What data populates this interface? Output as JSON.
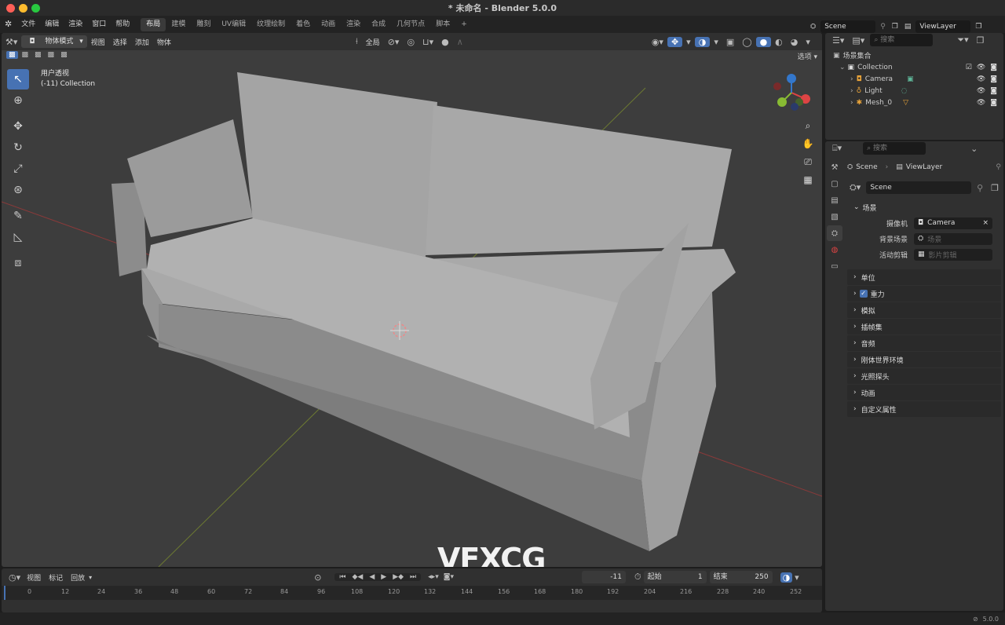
{
  "window": {
    "title": "* 未命名 - Blender 5.0.0"
  },
  "menu": {
    "items": [
      "文件",
      "编辑",
      "渲染",
      "窗口",
      "帮助"
    ],
    "workspaces": [
      "布局",
      "建模",
      "雕刻",
      "UV编辑",
      "纹理绘制",
      "着色",
      "动画",
      "渲染",
      "合成",
      "几何节点",
      "脚本"
    ],
    "add_tab": "+",
    "scene": "Scene",
    "view_layer": "ViewLayer"
  },
  "viewport": {
    "mode": "物体模式",
    "menus": [
      "视图",
      "选择",
      "添加",
      "物体"
    ],
    "orientation": "全局",
    "options_label": "选项",
    "overlay_title": "用户透视",
    "overlay_sub": "(-11) Collection"
  },
  "timeline": {
    "menus": [
      "视图",
      "标记",
      "回放"
    ],
    "current_frame": "-11",
    "start_label": "起始",
    "start": "1",
    "end_label": "结束",
    "end": "250",
    "ticks": [
      "0",
      "12",
      "24",
      "36",
      "48",
      "60",
      "72",
      "84",
      "96",
      "108",
      "120",
      "132",
      "144",
      "156",
      "168",
      "180",
      "192",
      "204",
      "216",
      "228",
      "240",
      "252"
    ]
  },
  "outliner": {
    "search_placeholder": "搜索",
    "root": "场景集合",
    "collection": "Collection",
    "objects": [
      "Camera",
      "Light",
      "Mesh_0"
    ]
  },
  "properties": {
    "search_placeholder": "搜索",
    "breadcrumb_scene": "Scene",
    "breadcrumb_layer": "ViewLayer",
    "scene_field": "Scene",
    "scene_section": "场景",
    "camera_label": "摄像机",
    "camera_value": "Camera",
    "bg_label": "背景场景",
    "bg_placeholder": "场景",
    "clip_label": "活动剪辑",
    "clip_placeholder": "影片剪辑",
    "sections": [
      "单位",
      "重力",
      "模拟",
      "插帧集",
      "音频",
      "刚体世界环境",
      "光照探头",
      "动画",
      "自定义属性"
    ]
  },
  "watermark": "VFXCG",
  "status": {
    "version": "5.0.0"
  },
  "colors": {
    "accent": "#4772b3",
    "viewport_bg": "#3d3d3d",
    "panel": "#303030"
  }
}
